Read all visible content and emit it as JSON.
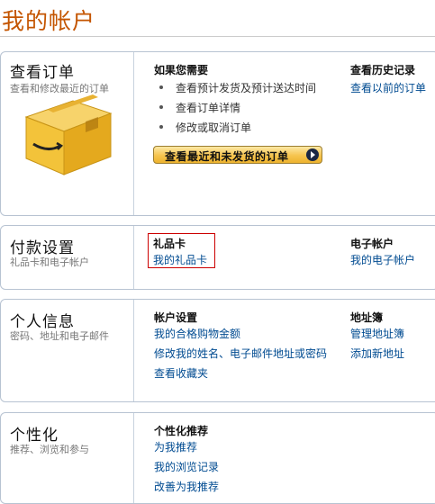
{
  "page": {
    "title": "我的帐户"
  },
  "orders": {
    "heading": "查看订单",
    "subtitle": "查看和修改最近的订单",
    "box_icon": "package-box-icon",
    "if_needed": {
      "title": "如果您需要",
      "items": [
        "查看预计发货及预计送达时间",
        "查看订单详情",
        "修改或取消订单"
      ]
    },
    "history": {
      "title": "查看历史记录",
      "link": "查看以前的订单"
    },
    "cta_label": "查看最近和未发货的订单"
  },
  "payment": {
    "heading": "付款设置",
    "subtitle": "礼品卡和电子帐户",
    "gift_card": {
      "title": "礼品卡",
      "link": "我的礼品卡"
    },
    "e_account": {
      "title": "电子帐户",
      "link": "我的电子帐户"
    }
  },
  "personal": {
    "heading": "个人信息",
    "subtitle": "密码、地址和电子邮件",
    "account_settings": {
      "title": "帐户设置",
      "links": [
        "我的合格购物金额",
        "修改我的姓名、电子邮件地址或密码",
        "查看收藏夹"
      ]
    },
    "address_book": {
      "title": "地址簿",
      "links": [
        "管理地址簿",
        "添加新地址"
      ]
    }
  },
  "personalize": {
    "heading": "个性化",
    "subtitle": "推荐、浏览和参与",
    "recommendations": {
      "title": "个性化推荐",
      "links": [
        "为我推荐",
        "我的浏览记录",
        "改善为我推荐"
      ]
    }
  },
  "colors": {
    "title": "#c45500",
    "link": "#004b91",
    "highlight": "#cc0000",
    "button": "#f6c44f"
  }
}
